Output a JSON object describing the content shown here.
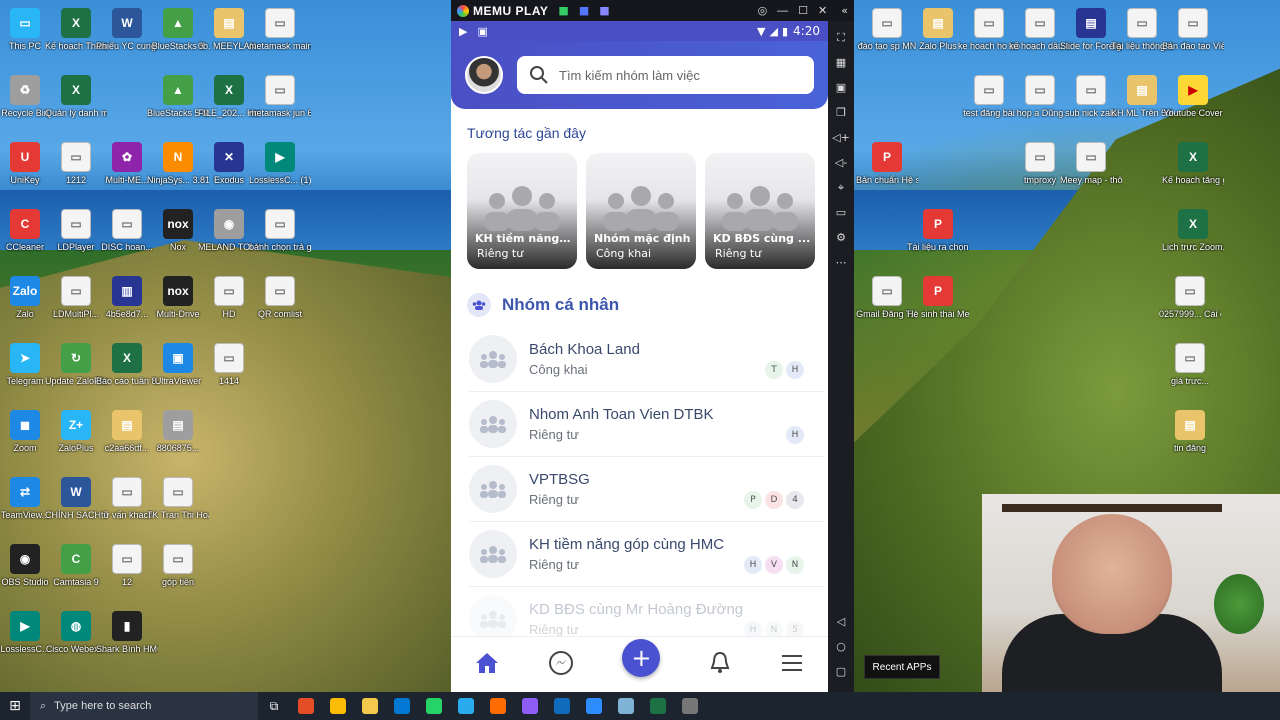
{
  "desktop": {
    "left_icons": [
      {
        "label": "This PC",
        "c": "c-cyan",
        "g": "▭"
      },
      {
        "label": "Kế hoạch Tháng 5 (1)",
        "c": "c-xls",
        "g": "X"
      },
      {
        "label": "Phiếu YC cung cấp...",
        "c": "c-doc",
        "g": "W"
      },
      {
        "label": "BlueStacks 5",
        "c": "c-green",
        "g": "▲"
      },
      {
        "label": "0b. MEEYLAN...",
        "c": "c-folder",
        "g": "▤"
      },
      {
        "label": "metamask main wall...",
        "c": "c-file",
        "g": "▭"
      },
      {
        "label": "Recycle Bin",
        "c": "c-gray",
        "g": "♻"
      },
      {
        "label": "Quản lý danh m...",
        "c": "c-xls",
        "g": "X"
      },
      {
        "label": "",
        "c": "",
        "g": ""
      },
      {
        "label": "BlueStacks 5 Multi-I...",
        "c": "c-green",
        "g": "▲"
      },
      {
        "label": "FILE_202... Hoàng Đ...",
        "c": "c-xls",
        "g": "X"
      },
      {
        "label": "metamask jun 6-...",
        "c": "c-file",
        "g": "▭"
      },
      {
        "label": "UniKey",
        "c": "c-red",
        "g": "U"
      },
      {
        "label": "1212",
        "c": "c-file",
        "g": "▭"
      },
      {
        "label": "Multi-ME...",
        "c": "c-purple",
        "g": "✿"
      },
      {
        "label": "NinjaSys... 3.81.exe",
        "c": "c-orange",
        "g": "N"
      },
      {
        "label": "Exodus",
        "c": "c-navy",
        "g": "✕"
      },
      {
        "label": "LosslessC... (1).exe - S...",
        "c": "c-teal",
        "g": "▶"
      },
      {
        "label": "CCleaner",
        "c": "c-red",
        "g": "C"
      },
      {
        "label": "LDPlayer",
        "c": "c-file",
        "g": "▭"
      },
      {
        "label": "DISC hoan...",
        "c": "c-file",
        "g": "▭"
      },
      {
        "label": "Nox",
        "c": "c-dark",
        "g": "nox"
      },
      {
        "label": "MELAND TOI YEU ...",
        "c": "c-gray",
        "g": "◉"
      },
      {
        "label": "bánh chọn trả góp",
        "c": "c-file",
        "g": "▭"
      },
      {
        "label": "Zalo",
        "c": "c-blue",
        "g": "Zalo"
      },
      {
        "label": "LDMultiPl...",
        "c": "c-file",
        "g": "▭"
      },
      {
        "label": "4b5e8d7...",
        "c": "c-navy",
        "g": "▥"
      },
      {
        "label": "Multi-Drive",
        "c": "c-dark",
        "g": "nox"
      },
      {
        "label": "HD",
        "c": "c-file",
        "g": "▭"
      },
      {
        "label": "QR comlist",
        "c": "c-file",
        "g": "▭"
      },
      {
        "label": "Telegram",
        "c": "c-cyan",
        "g": "➤"
      },
      {
        "label": "Update ZaloPlus",
        "c": "c-green",
        "g": "↻"
      },
      {
        "label": "Báo cáo tuần 8...",
        "c": "c-xls",
        "g": "X"
      },
      {
        "label": "UltraViewer",
        "c": "c-blue",
        "g": "▣"
      },
      {
        "label": "1414",
        "c": "c-file",
        "g": "▭"
      },
      {
        "label": "",
        "c": "",
        "g": ""
      },
      {
        "label": "Zoom",
        "c": "c-blue",
        "g": "◼"
      },
      {
        "label": "ZaloPlus",
        "c": "c-cyan",
        "g": "Z+"
      },
      {
        "label": "c2aa66df...",
        "c": "c-folder",
        "g": "▤"
      },
      {
        "label": "8806875...",
        "c": "c-gray",
        "g": "▤"
      },
      {
        "label": "",
        "c": "",
        "g": ""
      },
      {
        "label": "",
        "c": "",
        "g": ""
      },
      {
        "label": "TeamView...",
        "c": "c-blue",
        "g": "⇄"
      },
      {
        "label": "CHÍNH SÁCH T...",
        "c": "c-doc",
        "g": "W"
      },
      {
        "label": "tư vấn khách",
        "c": "c-file",
        "g": "▭"
      },
      {
        "label": "TK Tran Thi Hoa VIL...",
        "c": "c-file",
        "g": "▭"
      },
      {
        "label": "",
        "c": "",
        "g": ""
      },
      {
        "label": "",
        "c": "",
        "g": ""
      },
      {
        "label": "OBS Studio",
        "c": "c-dark",
        "g": "◉"
      },
      {
        "label": "Camtasia 9",
        "c": "c-green",
        "g": "C"
      },
      {
        "label": "12",
        "c": "c-file",
        "g": "▭"
      },
      {
        "label": "góp tiền",
        "c": "c-file",
        "g": "▭"
      },
      {
        "label": "",
        "c": "",
        "g": ""
      },
      {
        "label": "",
        "c": "",
        "g": ""
      },
      {
        "label": "LosslessC...",
        "c": "c-teal",
        "g": "▶"
      },
      {
        "label": "Cisco Webex...",
        "c": "c-teal",
        "g": "◍"
      },
      {
        "label": "Shark Bình HMC",
        "c": "c-dark",
        "g": "▮"
      }
    ],
    "right_icons": [
      {
        "label": "đào tạo sp MN",
        "c": "c-file",
        "g": "▭"
      },
      {
        "label": "Zalo Plus",
        "c": "c-folder",
        "g": "▤"
      },
      {
        "label": "ke hoach ho tro ...",
        "c": "c-file",
        "g": "▭"
      },
      {
        "label": "kế hoạch dầu tư",
        "c": "c-file",
        "g": "▭"
      },
      {
        "label": "Slide for Foreigners",
        "c": "c-navy",
        "g": "▤"
      },
      {
        "label": "Tài liệu thông ti...",
        "c": "c-file",
        "g": "▭"
      },
      {
        "label": "Bản đào tạo Viên...",
        "c": "c-file",
        "g": "▭"
      },
      {
        "label": "",
        "c": "",
        "g": ""
      },
      {
        "label": "",
        "c": "",
        "g": ""
      },
      {
        "label": "test đăng bài",
        "c": "c-file",
        "g": "▭"
      },
      {
        "label": "họp a Dũng",
        "c": "c-file",
        "g": "▭"
      },
      {
        "label": "sub nick zalo",
        "c": "c-file",
        "g": "▭"
      },
      {
        "label": "KH ML Trên 5000$",
        "c": "c-folder",
        "g": "▤"
      },
      {
        "label": "Youtube Cover",
        "c": "c-yellow",
        "g": "▶"
      },
      {
        "label": "Bản chuẩn Hệ sinh t...",
        "c": "c-red",
        "g": "P"
      },
      {
        "label": "",
        "c": "",
        "g": ""
      },
      {
        "label": "",
        "c": "",
        "g": ""
      },
      {
        "label": "tmproxy",
        "c": "c-file",
        "g": "▭"
      },
      {
        "label": "Meey map - thông ...",
        "c": "c-file",
        "g": "▭"
      },
      {
        "label": "",
        "c": "",
        "g": ""
      },
      {
        "label": "Kế hoạch tăng gi...",
        "c": "c-xls",
        "g": "X"
      },
      {
        "label": "",
        "c": "",
        "g": ""
      },
      {
        "label": "Tài liệu ra chọn Me...",
        "c": "c-red",
        "g": "P"
      },
      {
        "label": "",
        "c": "",
        "g": ""
      },
      {
        "label": "",
        "c": "",
        "g": ""
      },
      {
        "label": "",
        "c": "",
        "g": ""
      },
      {
        "label": "",
        "c": "",
        "g": ""
      },
      {
        "label": "Lịch trực Zoom...",
        "c": "c-xls",
        "g": "X"
      },
      {
        "label": "Gmail Đăng T...",
        "c": "c-file",
        "g": "▭"
      },
      {
        "label": "Hệ sinh thái Mee...",
        "c": "c-red",
        "g": "P"
      }
    ],
    "right_extra": [
      {
        "label": "0257999... Cái đất...",
        "c": "c-file",
        "g": "▭"
      },
      {
        "label": "giá trực...",
        "c": "c-file",
        "g": "▭"
      },
      {
        "label": "tin đăng",
        "c": "c-folder",
        "g": "▤"
      }
    ]
  },
  "emulator": {
    "brand": "MEMU PLAY",
    "status_time": "4:20",
    "search_placeholder": "Tìm kiếm nhóm làm việc",
    "recent_title": "Tương tác gần đây",
    "recent_cards": [
      {
        "title": "KH tiềm năng ...",
        "visibility": "Riêng tư"
      },
      {
        "title": "Nhóm mặc định",
        "visibility": "Công khai"
      },
      {
        "title": "KD BĐS cùng ...",
        "visibility": "Riêng tư"
      }
    ],
    "personal_title": "Nhóm cá nhân",
    "groups": [
      {
        "name": "Bách Khoa Land",
        "visibility": "Công khai",
        "members": [
          {
            "l": "T",
            "bg": "#e6f4ea"
          },
          {
            "l": "H",
            "bg": "#e3eaf7"
          }
        ]
      },
      {
        "name": "Nhom Anh Toan Vien DTBK",
        "visibility": "Riêng tư",
        "members": [
          {
            "l": "H",
            "bg": "#e3eaf7"
          }
        ]
      },
      {
        "name": "VPTBSG",
        "visibility": "Riêng tư",
        "members": [
          {
            "l": "P",
            "bg": "#e6f4ea"
          },
          {
            "l": "D",
            "bg": "#fbe3e3"
          },
          {
            "l": "4",
            "bg": "#e8e8ee"
          }
        ]
      },
      {
        "name": "KH tiềm năng góp cùng HMC",
        "visibility": "Riêng tư",
        "members": [
          {
            "l": "H",
            "bg": "#e3eaf7"
          },
          {
            "l": "V",
            "bg": "#f6dff3"
          },
          {
            "l": "N",
            "bg": "#e6f4ea"
          }
        ]
      },
      {
        "name": "KD BĐS cùng Mr Hoàng Đường",
        "visibility": "Riêng tư",
        "members": [
          {
            "l": "H",
            "bg": "#e3eaf7"
          },
          {
            "l": "N",
            "bg": "#e6f4ea"
          },
          {
            "l": "5",
            "bg": "#e8e8ee"
          }
        ]
      }
    ],
    "recent_apps_tooltip": "Recent APPs"
  },
  "taskbar": {
    "search_placeholder": "Type here to search",
    "apps": [
      "#e44d26",
      "#fbbc05",
      "#f2c94c",
      "#0078d4",
      "#25d366",
      "#2aabee",
      "#ff6b00",
      "#8e5cf7",
      "#0f6cbd",
      "#2d8cff",
      "#7fb3d5",
      "#1e7145",
      "#777"
    ]
  },
  "colors": {
    "accent": "#4a52d1",
    "header": "#4b4fc4",
    "text_dark": "#3a4a6b"
  }
}
